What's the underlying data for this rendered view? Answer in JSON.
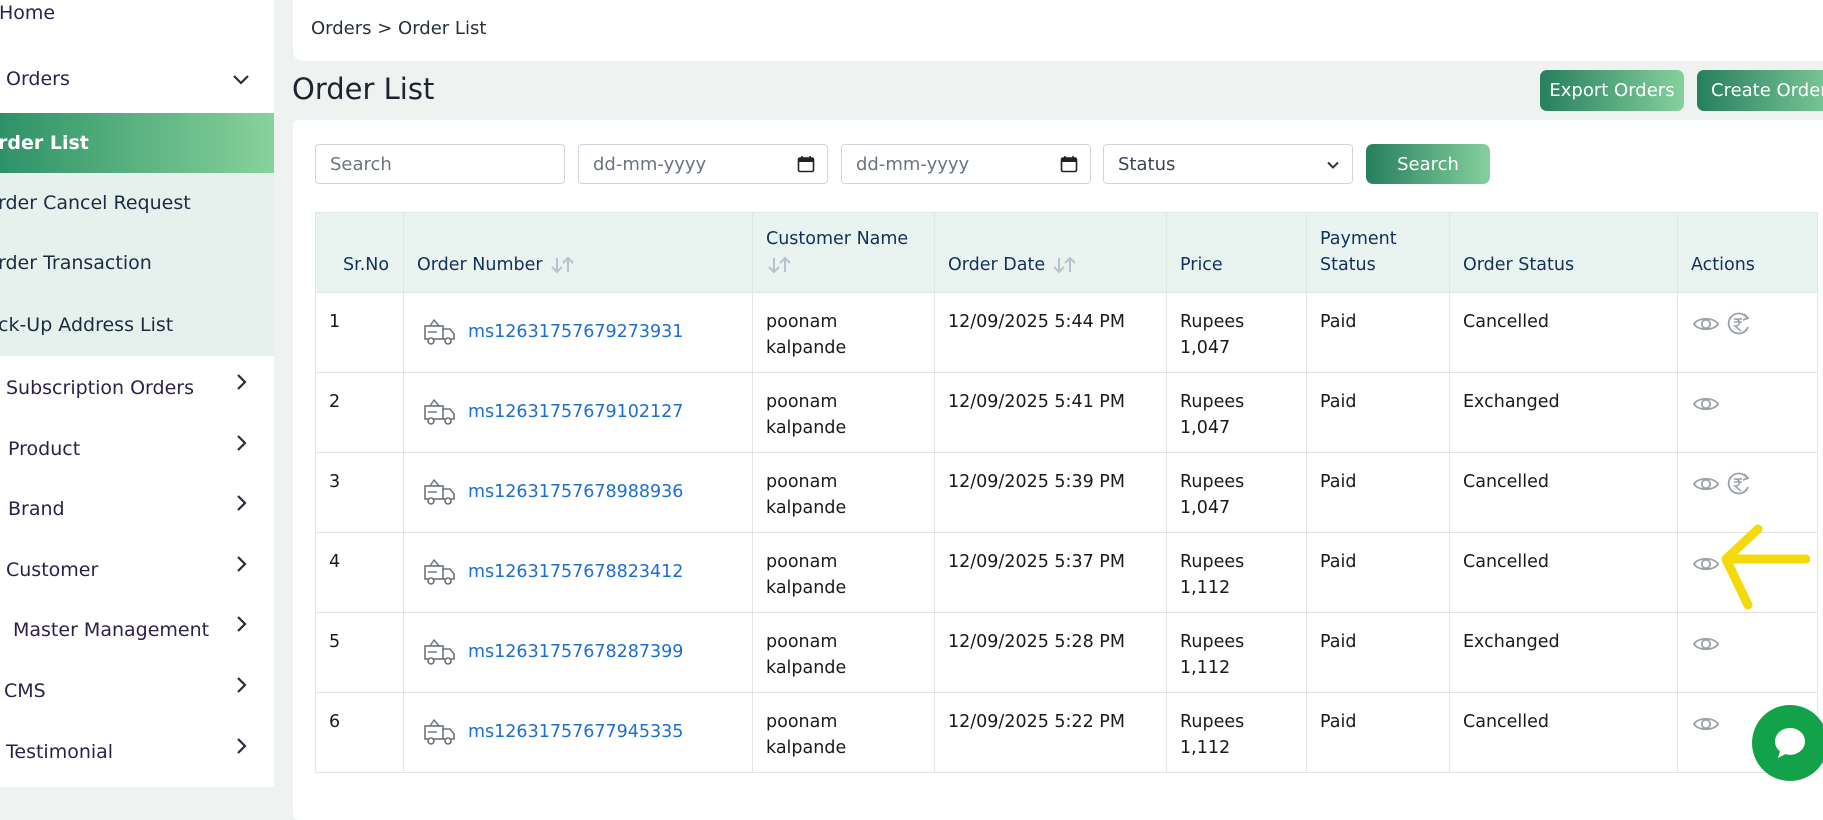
{
  "sidebar": {
    "items": [
      {
        "label": "Home"
      },
      {
        "label": "Orders"
      },
      {
        "label": "rder List"
      },
      {
        "label": "rder Cancel Request"
      },
      {
        "label": "rder Transaction"
      },
      {
        "label": "ck-Up Address List"
      },
      {
        "label": "Subscription Orders"
      },
      {
        "label": "Product"
      },
      {
        "label": "Brand"
      },
      {
        "label": "Customer"
      },
      {
        "label": "Master Management"
      },
      {
        "label": "CMS"
      },
      {
        "label": "Testimonial"
      }
    ]
  },
  "breadcrumb": "Orders > Order List",
  "page_title": "Order List",
  "buttons": {
    "export": "Export Orders",
    "create": "Create Order"
  },
  "filters": {
    "search_placeholder": "Search",
    "date_from": "dd-mm-yyyy",
    "date_to": "dd-mm-yyyy",
    "status": "Status",
    "search_button": "Search"
  },
  "table": {
    "headers": {
      "srno": "Sr.No",
      "order_number": "Order Number",
      "customer_name": "Customer Name",
      "order_date": "Order Date",
      "price": "Price",
      "payment_status": "Payment Status",
      "order_status": "Order Status",
      "actions": "Actions"
    },
    "rows": [
      {
        "srno": "1",
        "order_number": "ms12631757679273931",
        "customer": "poonam kalpande",
        "date": "12/09/2025 5:44 PM",
        "price": "Rupees 1,047",
        "payment": "Paid",
        "status": "Cancelled",
        "refund": true
      },
      {
        "srno": "2",
        "order_number": "ms12631757679102127",
        "customer": "poonam kalpande",
        "date": "12/09/2025 5:41 PM",
        "price": "Rupees 1,047",
        "payment": "Paid",
        "status": "Exchanged",
        "refund": false
      },
      {
        "srno": "3",
        "order_number": "ms12631757678988936",
        "customer": "poonam kalpande",
        "date": "12/09/2025 5:39 PM",
        "price": "Rupees 1,047",
        "payment": "Paid",
        "status": "Cancelled",
        "refund": true
      },
      {
        "srno": "4",
        "order_number": "ms12631757678823412",
        "customer": "poonam kalpande",
        "date": "12/09/2025 5:37 PM",
        "price": "Rupees 1,112",
        "payment": "Paid",
        "status": "Cancelled",
        "refund": false
      },
      {
        "srno": "5",
        "order_number": "ms12631757678287399",
        "customer": "poonam kalpande",
        "date": "12/09/2025 5:28 PM",
        "price": "Rupees 1,112",
        "payment": "Paid",
        "status": "Exchanged",
        "refund": false
      },
      {
        "srno": "6",
        "order_number": "ms12631757677945335",
        "customer": "poonam kalpande",
        "date": "12/09/2025 5:22 PM",
        "price": "Rupees 1,112",
        "payment": "Paid",
        "status": "Cancelled",
        "refund": false
      }
    ]
  },
  "colors": {
    "accent": "#2e9268",
    "link": "#1a6fd1",
    "annotation": "#f5d90a",
    "chat": "#13a24a"
  }
}
